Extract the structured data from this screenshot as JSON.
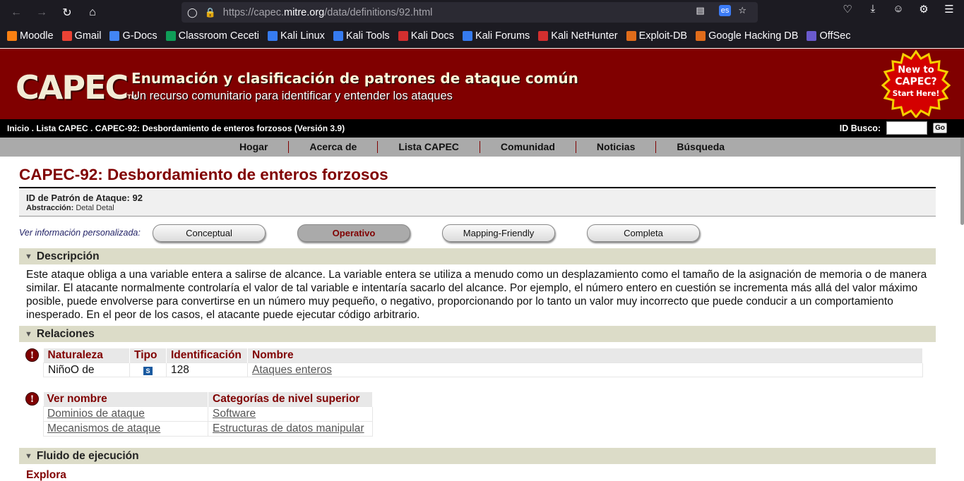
{
  "browser": {
    "url_prefix": "https://capec.",
    "url_domain": "mitre.org",
    "url_path": "/data/definitions/92.html",
    "translate_badge": "es"
  },
  "bookmarks": [
    {
      "label": "Moodle",
      "color": "#f98012"
    },
    {
      "label": "Gmail",
      "color": "#ea4335"
    },
    {
      "label": "G-Docs",
      "color": "#4285f4"
    },
    {
      "label": "Classroom Ceceti",
      "color": "#0f9d58"
    },
    {
      "label": "Kali Linux",
      "color": "#367bf0"
    },
    {
      "label": "Kali Tools",
      "color": "#367bf0"
    },
    {
      "label": "Kali Docs",
      "color": "#d32f2f"
    },
    {
      "label": "Kali Forums",
      "color": "#367bf0"
    },
    {
      "label": "Kali NetHunter",
      "color": "#d32f2f"
    },
    {
      "label": "Exploit-DB",
      "color": "#e06c1a"
    },
    {
      "label": "Google Hacking DB",
      "color": "#e06c1a"
    },
    {
      "label": "OffSec",
      "color": "#6a5acd"
    }
  ],
  "banner": {
    "logo": "CAPEC",
    "logo_tm": "TM",
    "title": "Enumación y clasificación de patrones de ataque común",
    "subtitle": "Un recurso comunitario para identificar y entender los ataques",
    "badge_line1": "New to",
    "badge_line2": "CAPEC?",
    "badge_line3": "Start Here!"
  },
  "crumb": {
    "text": "Inicio . Lista CAPEC . CAPEC-92: Desbordamiento de enteros forzosos (Versión 3.9)",
    "search_label": "ID Busco:",
    "go": "Go"
  },
  "menu": [
    "Hogar",
    "Acerca de",
    "Lista CAPEC",
    "Comunidad",
    "Noticias",
    "Búsqueda"
  ],
  "page_title": "CAPEC-92: Desbordamiento de enteros forzosos",
  "idbox": {
    "id_line": "ID de Patrón de Ataque: 92",
    "abstraction_label": "Abstracción:",
    "abstraction_value": "Detal Detal"
  },
  "views": {
    "label": "Ver información personalizada:",
    "buttons": [
      "Conceptual",
      "Operativo",
      "Mapping-Friendly",
      "Completa"
    ],
    "active": "Operativo"
  },
  "sections": {
    "description_title": "Descripción",
    "description_text": "Este ataque obliga a una variable entera a salirse de alcance. La variable entera se utiliza a menudo como un desplazamiento como el tamaño de la asignación de memoria o de manera similar. El atacante normalmente controlaría el valor de tal variable e intentaría sacarlo del alcance. Por ejemplo, el número entero en cuestión se incrementa más allá del valor máximo posible, puede envolverse para convertirse en un número muy pequeño, o negativo, proporcionando por lo tanto un valor muy incorrecto que puede conducir a un comportamiento inesperado. En el peor de los casos, el atacante puede ejecutar código arbitrario.",
    "relations_title": "Relaciones",
    "flow_title": "Fluido de ejecución",
    "explora": "Explora"
  },
  "relations_table": {
    "headers": [
      "Naturaleza",
      "Tipo",
      "Identificación",
      "Nombre"
    ],
    "row": {
      "nature": "NiñoO de",
      "type": "S",
      "id": "128",
      "name": "Ataques enteros"
    }
  },
  "views_table": {
    "headers": [
      "Ver nombre",
      "Categorías de nivel superior"
    ],
    "rows": [
      {
        "view": "Dominios de ataque",
        "category": "Software"
      },
      {
        "view": "Mecanismos de ataque",
        "category": "Estructuras de datos manipular"
      }
    ]
  }
}
